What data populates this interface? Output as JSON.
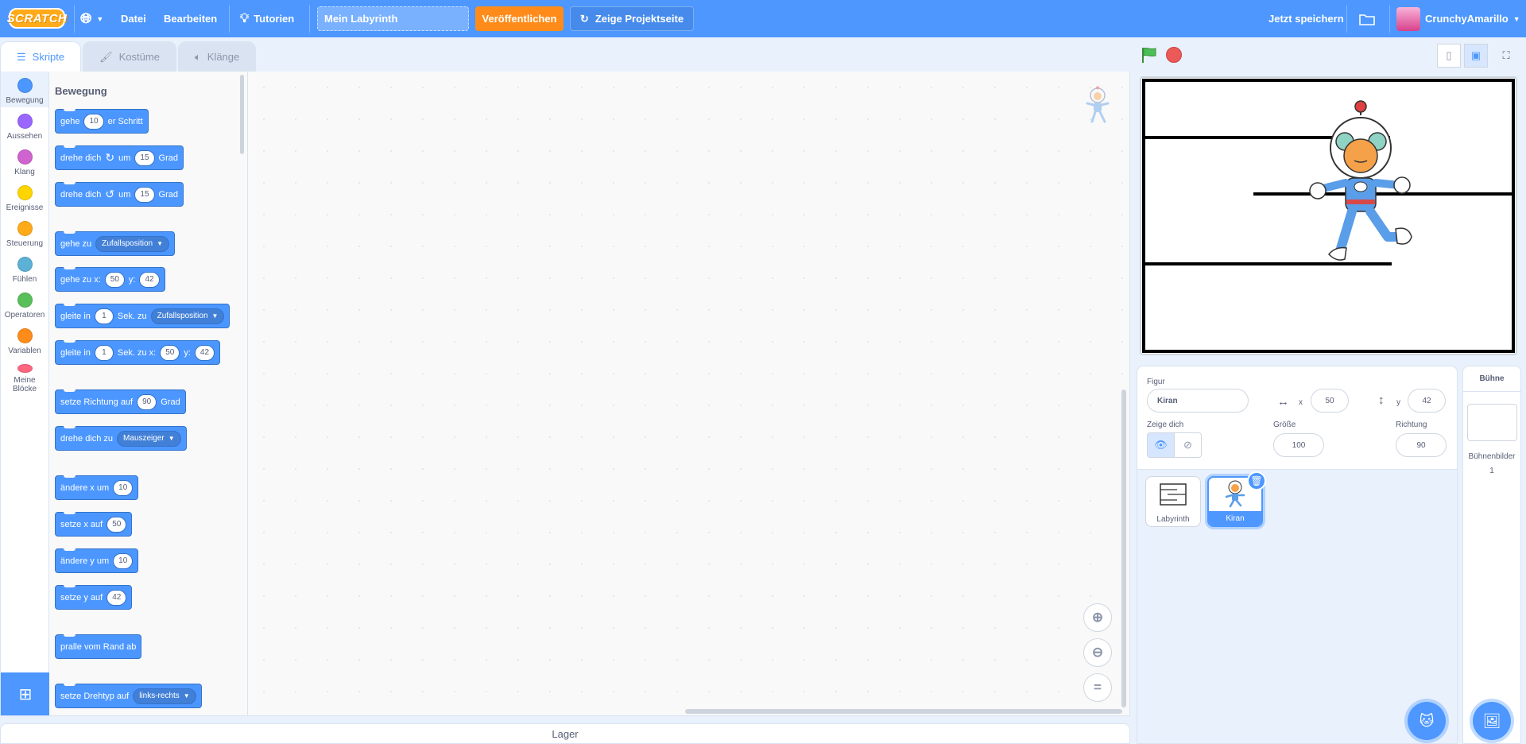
{
  "menubar": {
    "logo": "SCRATCH",
    "file": "Datei",
    "edit": "Bearbeiten",
    "tutorials": "Tutorien",
    "project_title": "Mein Labyrinth",
    "share": "Veröffentlichen",
    "see_project_page": "Zeige Projektseite",
    "save_now": "Jetzt speichern",
    "username": "CrunchyAmarillo"
  },
  "tabs": [
    {
      "label": "Skripte",
      "icon": "code-icon"
    },
    {
      "label": "Kostüme",
      "icon": "brush-icon"
    },
    {
      "label": "Klänge",
      "icon": "speaker-icon"
    }
  ],
  "categories": [
    {
      "label": "Bewegung",
      "color": "#4c97ff"
    },
    {
      "label": "Aussehen",
      "color": "#9966ff"
    },
    {
      "label": "Klang",
      "color": "#cf63cf"
    },
    {
      "label": "Ereignisse",
      "color": "#ffd500"
    },
    {
      "label": "Steuerung",
      "color": "#ffab19"
    },
    {
      "label": "Fühlen",
      "color": "#5cb1d6"
    },
    {
      "label": "Operatoren",
      "color": "#59c059"
    },
    {
      "label": "Variablen",
      "color": "#ff8c1a"
    },
    {
      "label": "Meine Blöcke",
      "color": "#ff6680"
    }
  ],
  "palette": {
    "title": "Bewegung",
    "blocks": {
      "move": {
        "a": "gehe",
        "n": "10",
        "b": "er Schritt"
      },
      "turn_right": {
        "a": "drehe dich",
        "b": "um",
        "n": "15",
        "c": "Grad"
      },
      "turn_left": {
        "a": "drehe dich",
        "b": "um",
        "n": "15",
        "c": "Grad"
      },
      "goto": {
        "a": "gehe zu",
        "dd": "Zufallsposition"
      },
      "goto_xy": {
        "a": "gehe zu x:",
        "x": "50",
        "b": "y:",
        "y": "42"
      },
      "glide_to": {
        "a": "gleite in",
        "n": "1",
        "b": "Sek. zu",
        "dd": "Zufallsposition"
      },
      "glide_xy": {
        "a": "gleite in",
        "n": "1",
        "b": "Sek. zu x:",
        "x": "50",
        "c": "y:",
        "y": "42"
      },
      "point_dir": {
        "a": "setze Richtung auf",
        "n": "90",
        "b": "Grad"
      },
      "point_towards": {
        "a": "drehe dich zu",
        "dd": "Mauszeiger"
      },
      "change_x": {
        "a": "ändere x um",
        "n": "10"
      },
      "set_x": {
        "a": "setze x auf",
        "n": "50"
      },
      "change_y": {
        "a": "ändere y um",
        "n": "10"
      },
      "set_y": {
        "a": "setze y auf",
        "n": "42"
      },
      "bounce": {
        "a": "pralle vom Rand ab"
      },
      "rotation_style": {
        "a": "setze Drehtyp auf",
        "dd": "links-rechts"
      }
    }
  },
  "backpack": "Lager",
  "sprite_info": {
    "sprite_label": "Figur",
    "sprite_name": "Kiran",
    "x_label": "x",
    "x": "50",
    "y_label": "y",
    "y": "42",
    "show_label": "Zeige dich",
    "size_label": "Größe",
    "size": "100",
    "direction_label": "Richtung",
    "direction": "90"
  },
  "sprites": [
    {
      "name": "Labyrinth",
      "selected": false
    },
    {
      "name": "Kiran",
      "selected": true
    }
  ],
  "stage_pane": {
    "title": "Bühne",
    "backdrops_label": "Bühnenbilder",
    "backdrops_count": "1"
  }
}
